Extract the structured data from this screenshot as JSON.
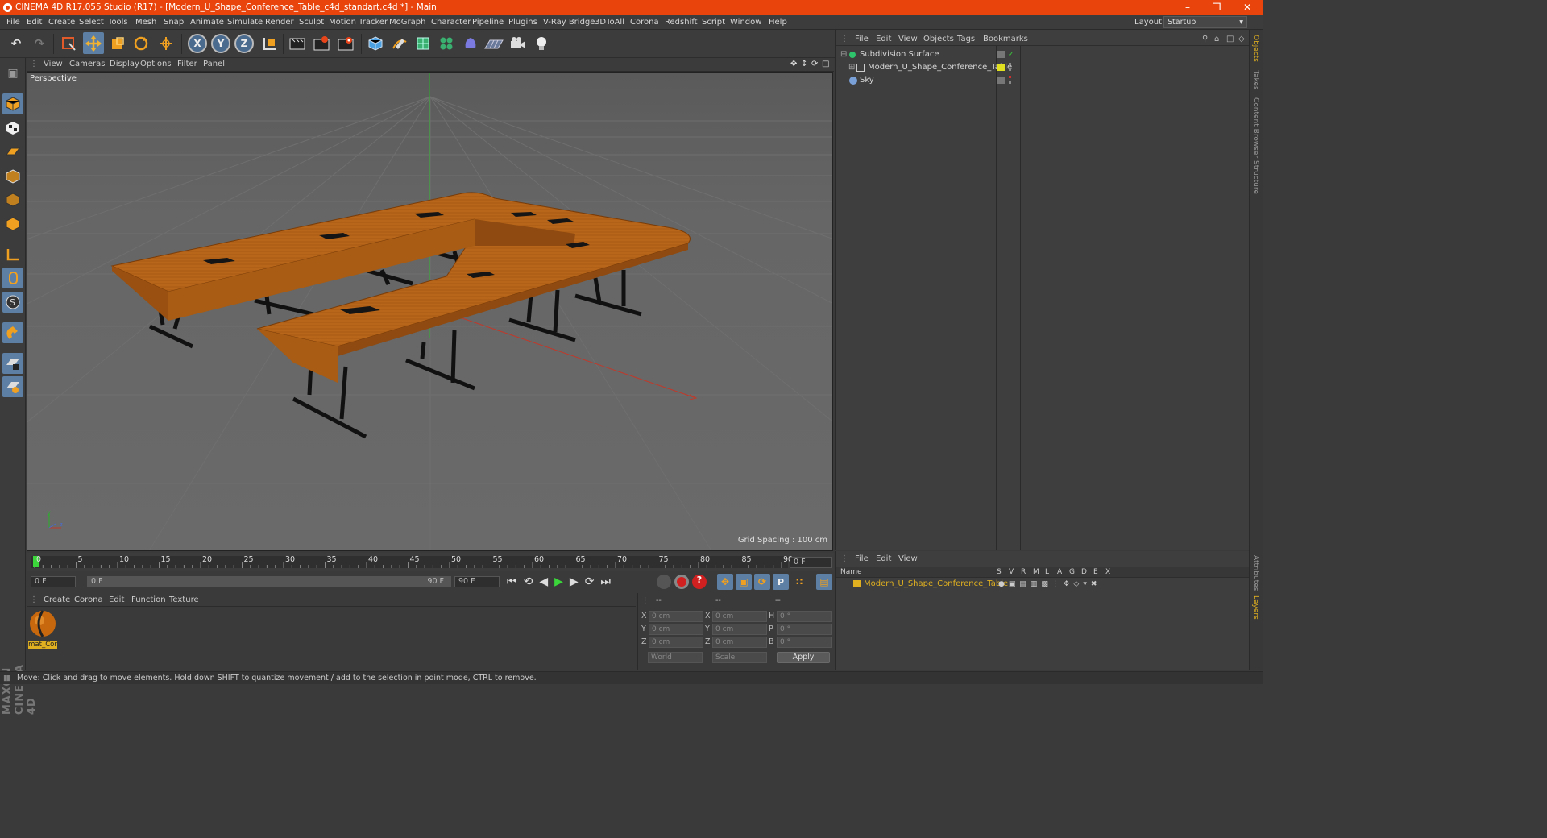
{
  "titlebar": {
    "title": "CINEMA 4D R17.055 Studio (R17) - [Modern_U_Shape_Conference_Table_c4d_standart.c4d *] - Main",
    "minimize": "–",
    "restore": "❐",
    "close": "✕"
  },
  "menubar": [
    "File",
    "Edit",
    "Create",
    "Select",
    "Tools",
    "Mesh",
    "Snap",
    "Animate",
    "Simulate",
    "Render",
    "Sculpt",
    "Motion Tracker",
    "MoGraph",
    "Character",
    "Pipeline",
    "Plugins",
    "V-Ray Bridge",
    "3DToAll",
    "Corona",
    "Redshift",
    "Script",
    "Window",
    "Help"
  ],
  "layout": {
    "label": "Layout:",
    "value": "Startup"
  },
  "toolbar": {
    "undo": "↶",
    "redo": "↷",
    "axis_x": "X",
    "axis_y": "Y",
    "axis_z": "Z",
    "icons": [
      "undo-icon",
      "redo-icon",
      "live-selection-icon",
      "move-icon",
      "scale-icon",
      "rotate-icon",
      "multi-tool-icon",
      "x-axis-icon",
      "y-axis-icon",
      "z-axis-icon",
      "world-coordinates-icon",
      "render-view-icon",
      "render-picture-viewer-icon",
      "edit-render-settings-icon",
      "cube-icon",
      "pen-icon",
      "subdivision-icon",
      "mograph-cloner-icon",
      "deformer-icon",
      "floor-icon",
      "camera-icon",
      "light-icon"
    ]
  },
  "viewport_menu": [
    "View",
    "Cameras",
    "Display",
    "Options",
    "Filter",
    "Panel"
  ],
  "viewport": {
    "label": "Perspective",
    "grid_spacing": "Grid Spacing : 100 cm"
  },
  "timeline": {
    "ticks": [
      "0",
      "5",
      "10",
      "15",
      "20",
      "25",
      "30",
      "35",
      "40",
      "45",
      "50",
      "55",
      "60",
      "65",
      "70",
      "75",
      "80",
      "85",
      "90"
    ],
    "current_frame": "0 F"
  },
  "range": {
    "start": "0 F",
    "range_start": "0 F",
    "range_end": "90 F",
    "end": "90 F"
  },
  "material_menu": [
    "Create",
    "Corona",
    "Edit",
    "Function",
    "Texture"
  ],
  "material": {
    "name": "mat_Cor"
  },
  "coords": {
    "header": [
      "--",
      "--",
      "--"
    ],
    "rows": [
      {
        "a": "X",
        "av": "0 cm",
        "b": "X",
        "bv": "0 cm",
        "c": "H",
        "cv": "0 °"
      },
      {
        "a": "Y",
        "av": "0 cm",
        "b": "Y",
        "bv": "0 cm",
        "c": "P",
        "cv": "0 °"
      },
      {
        "a": "Z",
        "av": "0 cm",
        "b": "Z",
        "bv": "0 cm",
        "c": "B",
        "cv": "0 °"
      }
    ],
    "mode1": "World",
    "mode2": "Scale",
    "apply": "Apply"
  },
  "objects_menu": [
    "File",
    "Edit",
    "View",
    "Objects",
    "Tags",
    "Bookmarks"
  ],
  "objects": [
    {
      "name": "Subdivision Surface",
      "color": "#2ec46b"
    },
    {
      "name": "Modern_U_Shape_Conference_Table",
      "color": "#e0e020"
    },
    {
      "name": "Sky",
      "color": "#7aa0d8"
    }
  ],
  "layers_menu": [
    "File",
    "Edit",
    "View"
  ],
  "layers_header": {
    "name": "Name",
    "cols": [
      "S",
      "V",
      "R",
      "M",
      "L",
      "A",
      "G",
      "D",
      "E",
      "X"
    ]
  },
  "layer": {
    "name": "Modern_U_Shape_Conference_Table",
    "color": "#e0b020"
  },
  "right_tabs": [
    "Objects",
    "Takes",
    "Content Browser",
    "Structure",
    "Attributes",
    "Layers"
  ],
  "status": "Move: Click and drag to move elements. Hold down SHIFT to quantize movement / add to the selection in point mode, CTRL to remove.",
  "brand": "MAXON CINEMA 4D"
}
